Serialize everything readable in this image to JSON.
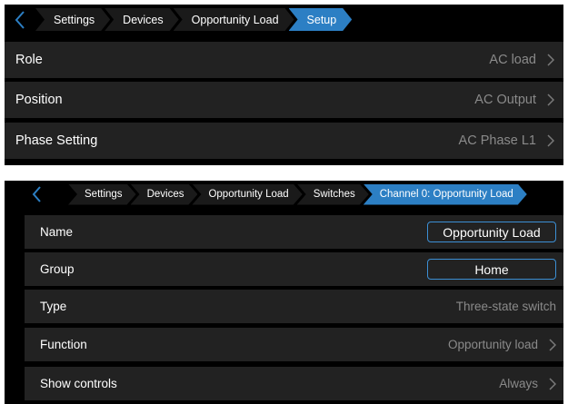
{
  "setup_panel": {
    "breadcrumb": [
      "Settings",
      "Devices",
      "Opportunity Load",
      "Setup"
    ],
    "rows": [
      {
        "label": "Role",
        "value": "AC load"
      },
      {
        "label": "Position",
        "value": "AC Output"
      },
      {
        "label": "Phase Setting",
        "value": "AC Phase L1"
      }
    ]
  },
  "channel_panel": {
    "breadcrumb": [
      "Settings",
      "Devices",
      "Opportunity Load",
      "Switches",
      "Channel 0: Opportunity Load"
    ],
    "name": {
      "label": "Name",
      "value": "Opportunity Load"
    },
    "group": {
      "label": "Group",
      "value": "Home"
    },
    "type": {
      "label": "Type",
      "value": "Three-state switch"
    },
    "function": {
      "label": "Function",
      "value": "Opportunity load"
    },
    "show_controls": {
      "label": "Show controls",
      "value": "Always"
    }
  },
  "colors": {
    "accent": "#2c7fc4",
    "row_bg": "#222222",
    "panel_bg": "#000000",
    "value_text": "#8a8a8a"
  }
}
